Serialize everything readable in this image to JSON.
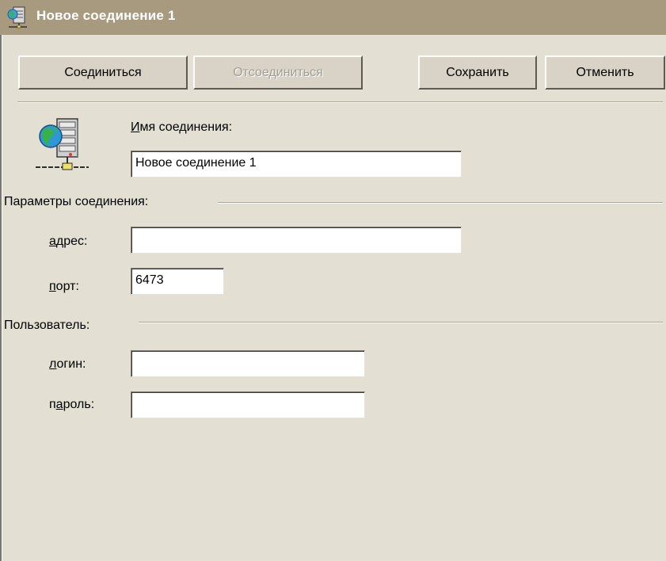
{
  "window": {
    "title": "Новое соединение 1"
  },
  "toolbar": {
    "connect_label": "Соединиться",
    "disconnect_label": "Отсоединиться",
    "save_label": "Сохранить",
    "cancel_label": "Отменить"
  },
  "connection_name": {
    "label_accel": "И",
    "label_rest": "мя соединения:",
    "value": "Новое соединение 1"
  },
  "connection_params": {
    "group_label": "Параметры соединения:",
    "address": {
      "label_accel": "а",
      "label_rest": "дрес:",
      "value": ""
    },
    "port": {
      "label_accel": "п",
      "label_rest": "орт:",
      "value": "6473"
    }
  },
  "user": {
    "group_label": "Пользователь:",
    "login": {
      "label_accel": "л",
      "label_rest": "огин:",
      "value": ""
    },
    "password": {
      "label_pre": "п",
      "label_accel": "а",
      "label_rest": "роль:",
      "value": ""
    }
  },
  "icons": {
    "title_icon": "network-server-icon",
    "server_icon": "network-server-globe-icon"
  }
}
